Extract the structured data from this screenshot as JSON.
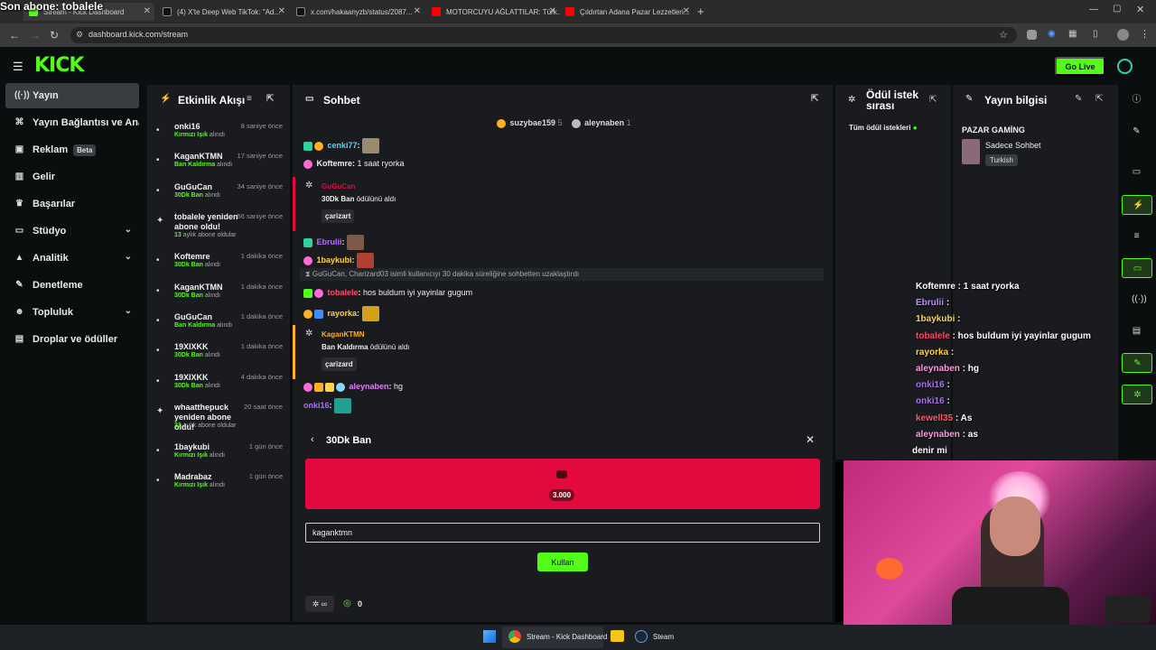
{
  "overlay": {
    "last_sub": "Son abone: tobalele"
  },
  "tabs": [
    {
      "label": "Stream - Kick Dashboard",
      "fav": "#53fc18"
    },
    {
      "label": "(4) X'te Deep Web TikTok: \"Ad...",
      "fav": "#111111"
    },
    {
      "label": "x.com/hakaanyzb/status/2087...",
      "fav": "#111111"
    },
    {
      "label": "MOTORCUYU AĞLATTILAR: Türk...",
      "fav": "#ff0000"
    },
    {
      "label": "Çıldırtan Adana Pazar Lezzetleri...",
      "fav": "#ff0000"
    }
  ],
  "browser": {
    "url": "dashboard.kick.com/stream"
  },
  "header": {
    "logo": "KICK",
    "go_live": "Go Live"
  },
  "nav": [
    {
      "label": "Yayın",
      "icon": "broadcast-icon",
      "glyph": "((·))",
      "active": true
    },
    {
      "label": "Yayın Bağlantısı ve Anahtarı",
      "icon": "link-icon",
      "glyph": "⌘"
    },
    {
      "label": "Reklam",
      "icon": "ad-icon",
      "glyph": "▣",
      "badge": "Beta"
    },
    {
      "label": "Gelir",
      "icon": "revenue-icon",
      "glyph": "▥"
    },
    {
      "label": "Başarılar",
      "icon": "trophy-icon",
      "glyph": "♛"
    },
    {
      "label": "Stüdyo",
      "icon": "studio-icon",
      "glyph": "▭",
      "chevron": true
    },
    {
      "label": "Analitik",
      "icon": "analytics-icon",
      "glyph": "▲",
      "chevron": true
    },
    {
      "label": "Denetleme",
      "icon": "wrench-icon",
      "glyph": "✎"
    },
    {
      "label": "Topluluk",
      "icon": "community-icon",
      "glyph": "☻",
      "chevron": true
    },
    {
      "label": "Droplar ve ödüller",
      "icon": "gift-icon",
      "glyph": "▤"
    }
  ],
  "activity": {
    "title": "Etkinlik Akışı",
    "items": [
      {
        "name": "onki16",
        "time": "8 saniye önce",
        "sub_highlight": "Kırmızı Işık",
        "sub_rest": " alındı",
        "icon": "•"
      },
      {
        "name": "KaganKTMN",
        "time": "17 saniye önce",
        "sub_highlight": "Ban Kaldırma",
        "sub_rest": " alındı",
        "icon": "•"
      },
      {
        "name": "GuGuCan",
        "time": "34 saniye önce",
        "sub_highlight": "30Dk Ban",
        "sub_rest": " alındı",
        "icon": "•"
      },
      {
        "name": "tobalele yeniden abone oldu!",
        "time": "56 saniye önce",
        "sub_highlight": "13",
        "sub_rest": " aylık abone oldular",
        "icon": "✦"
      },
      {
        "name": "Koftemre",
        "time": "1 dakika önce",
        "sub_highlight": "30Dk Ban",
        "sub_rest": " alındı",
        "icon": "•"
      },
      {
        "name": "KaganKTMN",
        "time": "1 dakika önce",
        "sub_highlight": "30Dk Ban",
        "sub_rest": " alındı",
        "icon": "•"
      },
      {
        "name": "GuGuCan",
        "time": "1 dakika önce",
        "sub_highlight": "Ban Kaldırma",
        "sub_rest": " alındı",
        "icon": "•"
      },
      {
        "name": "19XIXKK",
        "time": "1 dakika önce",
        "sub_highlight": "30Dk Ban",
        "sub_rest": " alındı",
        "icon": "•"
      },
      {
        "name": "19XIXKK",
        "time": "4 dakika önce",
        "sub_highlight": "30Dk Ban",
        "sub_rest": " alındı",
        "icon": "•"
      },
      {
        "name": "whaatthepuck yeniden abone oldu!",
        "time": "20 saat önce",
        "sub_highlight": "31",
        "sub_rest": " aylık abone oldular",
        "icon": "✦"
      },
      {
        "name": "1baykubi",
        "time": "1 gün önce",
        "sub_highlight": "Kırmızı Işık",
        "sub_rest": " alındı",
        "icon": "•"
      },
      {
        "name": "Madrabaz",
        "time": "1 gün önce",
        "sub_highlight": "Kırmızı Işık",
        "sub_rest": " alındı",
        "icon": "•"
      }
    ]
  },
  "chat": {
    "title": "Sohbet",
    "top_gifters": [
      {
        "name": "suzybae159",
        "count": "5"
      },
      {
        "name": "aleynaben",
        "count": "1"
      }
    ],
    "lines": [
      {
        "user": "cenki77",
        "color": "#5ad5f5",
        "text": "",
        "sep": ":"
      },
      {
        "user": "Koftemre",
        "color": "#ffffff",
        "text": " 1 saat ryorka",
        "sep": ":"
      },
      {
        "user": "Ebrulii",
        "color": "#b46bff",
        "text": "",
        "sep": ":"
      },
      {
        "user": "1baykubi",
        "color": "#ffd24a",
        "text": "",
        "sep": ":"
      },
      {
        "user": "tobalele",
        "color": "#ff4d6a",
        "text": " hos buldum iyi yayinlar gugum",
        "sep": ":"
      },
      {
        "user": "rayorka",
        "color": "#ffd24a",
        "text": "",
        "sep": ":"
      },
      {
        "user": "aleynaben",
        "color": "#e27bff",
        "text": " hg",
        "sep": ":"
      },
      {
        "user": "onki16",
        "color": "#b46bff",
        "text": "",
        "sep": ":"
      }
    ],
    "system": "GuGuCan, Charizard03 isimli kullanıcıyı 30 dakika süreliğine sohbetten uzaklaştırdı",
    "redeems": [
      {
        "user": "GuGuCan",
        "reward": "30Dk Ban",
        "suffix": " ödülünü aldı",
        "target": "çarizart",
        "color": "#e3093e"
      },
      {
        "user": "KaganKTMN",
        "reward": "Ban Kaldırma",
        "suffix": " ödülünü aldı",
        "target": "çarizard",
        "color": "#ffb020"
      }
    ],
    "reward_panel": {
      "title": "30Dk Ban",
      "cost": "3.000",
      "input_value": "kaganktmn",
      "submit": "Kullan"
    },
    "footer_points": "0"
  },
  "requests": {
    "title": "Ödül istek sırası",
    "all": "Tüm ödül istekleri"
  },
  "stream_info": {
    "title": "Yayın bilgisi",
    "stream_title": "PAZAR GAMİNG",
    "category": "Sadece Sohbet",
    "tag": "Turkish"
  },
  "overlay_chat": [
    {
      "user": "Koftemre",
      "color": "#ffffff",
      "text": " : 1 saat ryorka"
    },
    {
      "user": "Ebrulii",
      "color": "#c08bff",
      "text": " :"
    },
    {
      "user": "1baykubi",
      "color": "#ffd24a",
      "text": " :"
    },
    {
      "user": "tobalele",
      "color": "#ff4d6a",
      "text": " : hos buldum iyi yayinlar gugum"
    },
    {
      "user": "rayorka",
      "color": "#ffd24a",
      "text": " :"
    },
    {
      "user": "aleynaben",
      "color": "#ff9be0",
      "text": " : hg"
    },
    {
      "user": "onki16",
      "color": "#b46bff",
      "text": " :"
    },
    {
      "user": "onki16",
      "color": "#b46bff",
      "text": " :"
    },
    {
      "user": "kewell35",
      "color": "#ff5a6a",
      "text": " : As"
    },
    {
      "user": "aleynaben",
      "color": "#ff9be0",
      "text": " : as"
    },
    {
      "user": "",
      "color": "#ffffff",
      "text": "denir mi"
    }
  ],
  "taskbar": {
    "chrome_label": "Stream - Kick Dashboard",
    "steam_label": "Steam"
  }
}
